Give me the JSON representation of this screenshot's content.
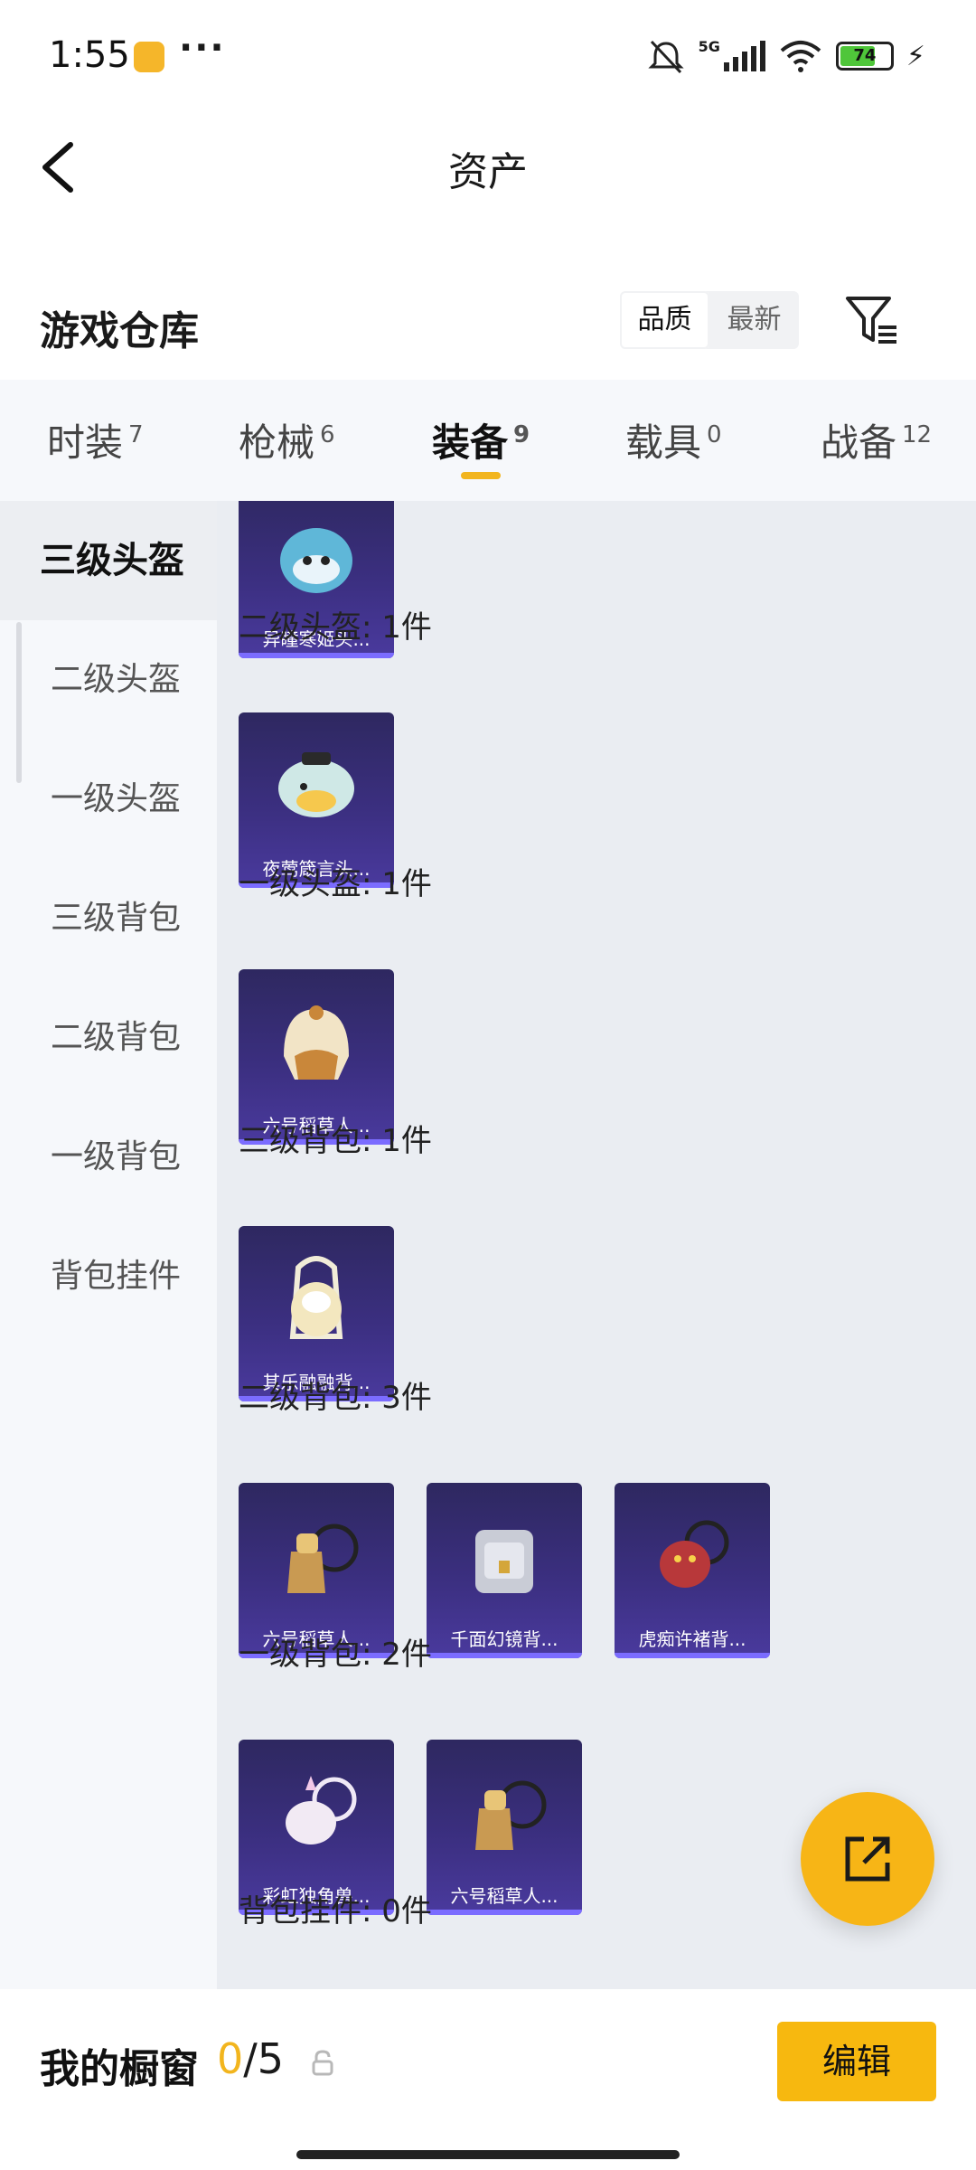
{
  "status_bar": {
    "time": "1:55",
    "network": "5G",
    "battery": "74"
  },
  "header": {
    "title": "资产"
  },
  "warehouse": {
    "title": "游戏仓库",
    "sort_options": [
      "品质",
      "最新"
    ],
    "sort_selected": "品质"
  },
  "tabs": [
    {
      "label": "时装",
      "count": "7"
    },
    {
      "label": "枪械",
      "count": "6"
    },
    {
      "label": "装备",
      "count": "9",
      "active": true
    },
    {
      "label": "载具",
      "count": "0"
    },
    {
      "label": "战备",
      "count": "12"
    }
  ],
  "categories": [
    "三级头盔",
    "二级头盔",
    "一级头盔",
    "三级背包",
    "二级背包",
    "一级背包",
    "背包挂件"
  ],
  "active_category": "三级头盔",
  "groups": [
    {
      "label": "",
      "items": [
        "异瞳寒姬头..."
      ]
    },
    {
      "label": "二级头盔: 1件",
      "items": [
        "夜莺箴言头..."
      ]
    },
    {
      "label": "一级头盔: 1件",
      "items": [
        "六号稻草人..."
      ]
    },
    {
      "label": "三级背包: 1件",
      "items": [
        "其乐融融背..."
      ]
    },
    {
      "label": "二级背包: 3件",
      "items": [
        "六号稻草人...",
        "千面幻镜背...",
        "虎痴许褚背..."
      ]
    },
    {
      "label": "一级背包: 2件",
      "items": [
        "彩虹独角兽...",
        "六号稻草人..."
      ]
    },
    {
      "label": "背包挂件: 0件",
      "items": []
    }
  ],
  "bottom_bar": {
    "label": "我的橱窗",
    "count_current": "0",
    "count_total": "/5",
    "edit_label": "编辑"
  },
  "colors": {
    "accent": "#f7b80f",
    "card_bg": "#3b2f80",
    "content_bg": "#eaedf2"
  }
}
